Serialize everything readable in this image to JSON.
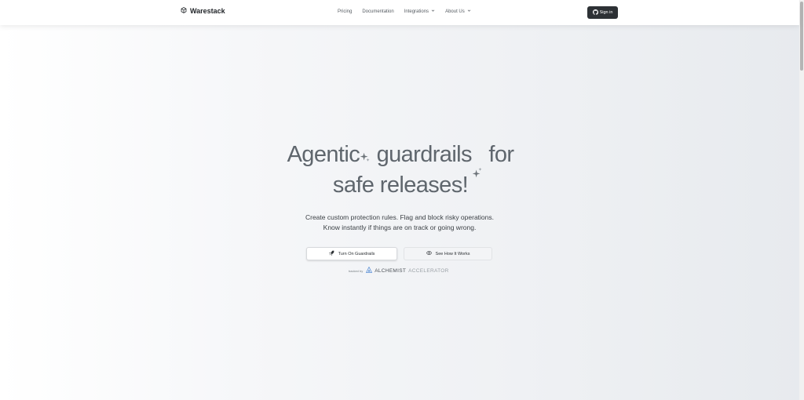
{
  "nav": {
    "brand": "Warestack",
    "links": [
      {
        "label": "Pricing",
        "dropdown": false
      },
      {
        "label": "Documentation",
        "dropdown": false
      },
      {
        "label": "Integrations",
        "dropdown": true
      },
      {
        "label": "About Us",
        "dropdown": true
      }
    ],
    "signin_label": "Sign in"
  },
  "hero": {
    "title_part1": "Agentic",
    "title_part2": "guardrails",
    "title_part3": "for",
    "title_line2": "safe releases!",
    "subtitle_line1": "Create custom protection rules. Flag and block risky operations.",
    "subtitle_line2": "Know instantly if things are on track or going wrong.",
    "primary_button": "Turn On Guardrails",
    "secondary_button": "See How It Works",
    "backed_by": "backed by",
    "backer_bold": "ALCHEMIST",
    "backer_light": "ACCELERATOR"
  },
  "colors": {
    "accent": "#2d3135",
    "title": "#5f666d",
    "background_end": "#e7eaee"
  },
  "icons": {
    "brand": "cube-icon",
    "signin": "github-icon",
    "primary": "rocket-icon",
    "secondary": "eye-icon",
    "sparkle": "sparkle-icon",
    "backer": "alchemist-logo-icon"
  }
}
